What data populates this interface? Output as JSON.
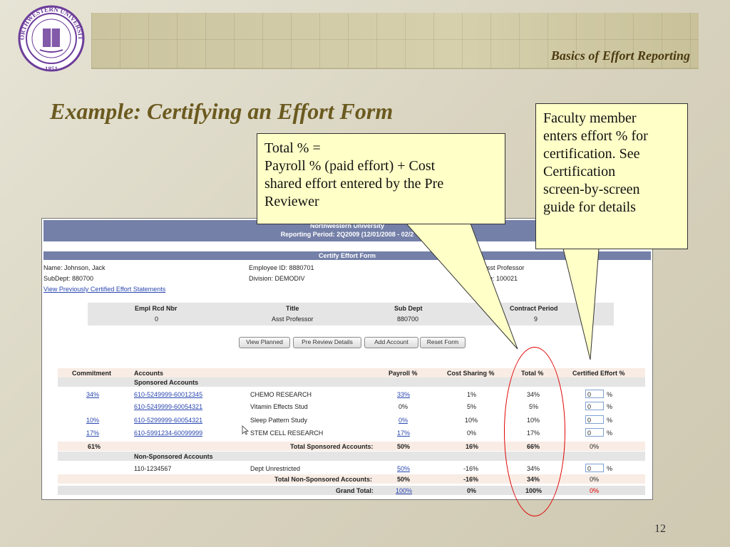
{
  "slide": {
    "header_title": "Basics of Effort Reporting",
    "title": "Example: Certifying an Effort Form",
    "page_number": "12",
    "seal": {
      "top": "NORTHWESTERN UNIVERSITY",
      "bottom": "1851"
    }
  },
  "callouts": {
    "total": [
      "Total % =",
      "Payroll % (paid effort) + Cost",
      "shared effort entered by the Pre",
      "Reviewer"
    ],
    "faculty": [
      "Faculty member",
      "enters effort % for",
      "certification. See",
      "Certification",
      "screen-by-screen",
      "guide for details"
    ]
  },
  "app": {
    "university": "Northwestern University",
    "reporting_period": "Reporting Period: 2Q2009 (12/01/2008 - 02/2",
    "form_title": "Certify Effort Form",
    "employee": {
      "name": "Name: Johnson, Jack",
      "subdept": "SubDept: 880700",
      "history_link": "View Previously Certified Effort Statements",
      "employee_id": "Employee ID: 8880701",
      "division": "Division: DEMODIV",
      "title_partial": "Asst Professor",
      "code_partial": "de: 100021"
    },
    "summary": {
      "headers": [
        "Empl Rcd Nbr",
        "Title",
        "Sub Dept",
        "Contract Period"
      ],
      "values": [
        "0",
        "Asst Professor",
        "880700",
        "9"
      ]
    },
    "buttons": {
      "view_planned": "View Planned",
      "pre_review": "Pre Review Details",
      "add_account": "Add Account",
      "reset_form": "Reset Form"
    },
    "table": {
      "headers": {
        "commitment": "Commitment",
        "accounts": "Accounts",
        "payroll": "Payroll %",
        "cost_sharing": "Cost Sharing %",
        "total": "Total %",
        "certified": "Certified Effort %"
      },
      "sponsored_label": "Sponsored Accounts",
      "sponsored_rows": [
        {
          "commitment": "34%",
          "account": "610-5249999-60012345",
          "name": "CHEMO RESEARCH",
          "payroll": "33%",
          "cost": "1%",
          "total": "34%",
          "input": "0"
        },
        {
          "commitment": "",
          "account": "610-5249999-60054321",
          "name": "Vitamin Effects Stud",
          "payroll": "0%",
          "cost": "5%",
          "total": "5%",
          "input": "0"
        },
        {
          "commitment": "10%",
          "account": "610-5299999-60054321",
          "name": "Sleep Pattern Study",
          "payroll": "0%",
          "cost": "10%",
          "total": "10%",
          "input": "0"
        },
        {
          "commitment": "17%",
          "account": "610-5991234-60099999",
          "name": "STEM CELL RESEARCH",
          "payroll": "17%",
          "cost": "0%",
          "total": "17%",
          "input": "0"
        }
      ],
      "sponsored_total": {
        "commitment": "61%",
        "label": "Total Sponsored Accounts:",
        "payroll": "50%",
        "cost": "16%",
        "total": "66%",
        "certified": "0%"
      },
      "nonsponsored_label": "Non-Sponsored Accounts",
      "nonsponsored_row": {
        "account": "110-1234567",
        "name": "Dept Unrestricted",
        "payroll": "50%",
        "cost": "-16%",
        "total": "34%",
        "input": "0"
      },
      "nonsponsored_total": {
        "label": "Total Non-Sponsored Accounts:",
        "payroll": "50%",
        "cost": "-16%",
        "total": "34%",
        "certified": "0%"
      },
      "grand_total": {
        "label": "Grand Total:",
        "payroll": "100%",
        "cost": "0%",
        "total": "100%",
        "certified": "0%"
      },
      "pct_sign": "%"
    }
  },
  "colors": {
    "title": "#6b5a1f",
    "header_bar": "#7480a8",
    "callout": "#ffffc8",
    "highlight": "#e00000"
  }
}
